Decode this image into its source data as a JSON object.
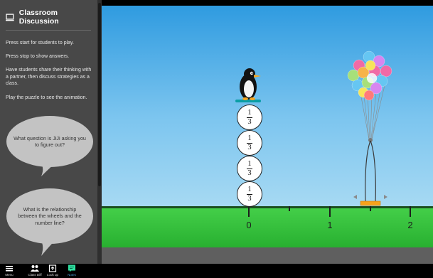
{
  "sidebar": {
    "title": "Classroom Discussion",
    "instructions": [
      "Press start for students to play.",
      "Press stop to show answers.",
      "Have students share their thinking with a partner, then discuss strategies as a class.",
      "Play the puzzle to see the animation."
    ],
    "questions": [
      "What question is JiJi asking you to figure out?",
      "What is the relationship between the wheels and the number line?"
    ]
  },
  "game": {
    "wheel_stack": [
      {
        "numerator": "1",
        "denominator": "3"
      },
      {
        "numerator": "1",
        "denominator": "3"
      },
      {
        "numerator": "1",
        "denominator": "3"
      },
      {
        "numerator": "1",
        "denominator": "3"
      }
    ],
    "number_line_labels": [
      "0",
      "1",
      "2"
    ]
  },
  "toolbar": {
    "items": [
      {
        "label": "Menu",
        "icon": "hamburger-icon"
      },
      {
        "label": "Class Diff",
        "icon": "people-icon"
      },
      {
        "label": "Look up",
        "icon": "lookup-icon"
      },
      {
        "label": "Notes",
        "icon": "notes-icon"
      }
    ]
  },
  "colors": {
    "sidebar_bg": "#484848",
    "sky": "#5cb3ea",
    "ground": "#3ec244",
    "platform": "#f7a21b",
    "active_tool": "#4a9fd0"
  }
}
